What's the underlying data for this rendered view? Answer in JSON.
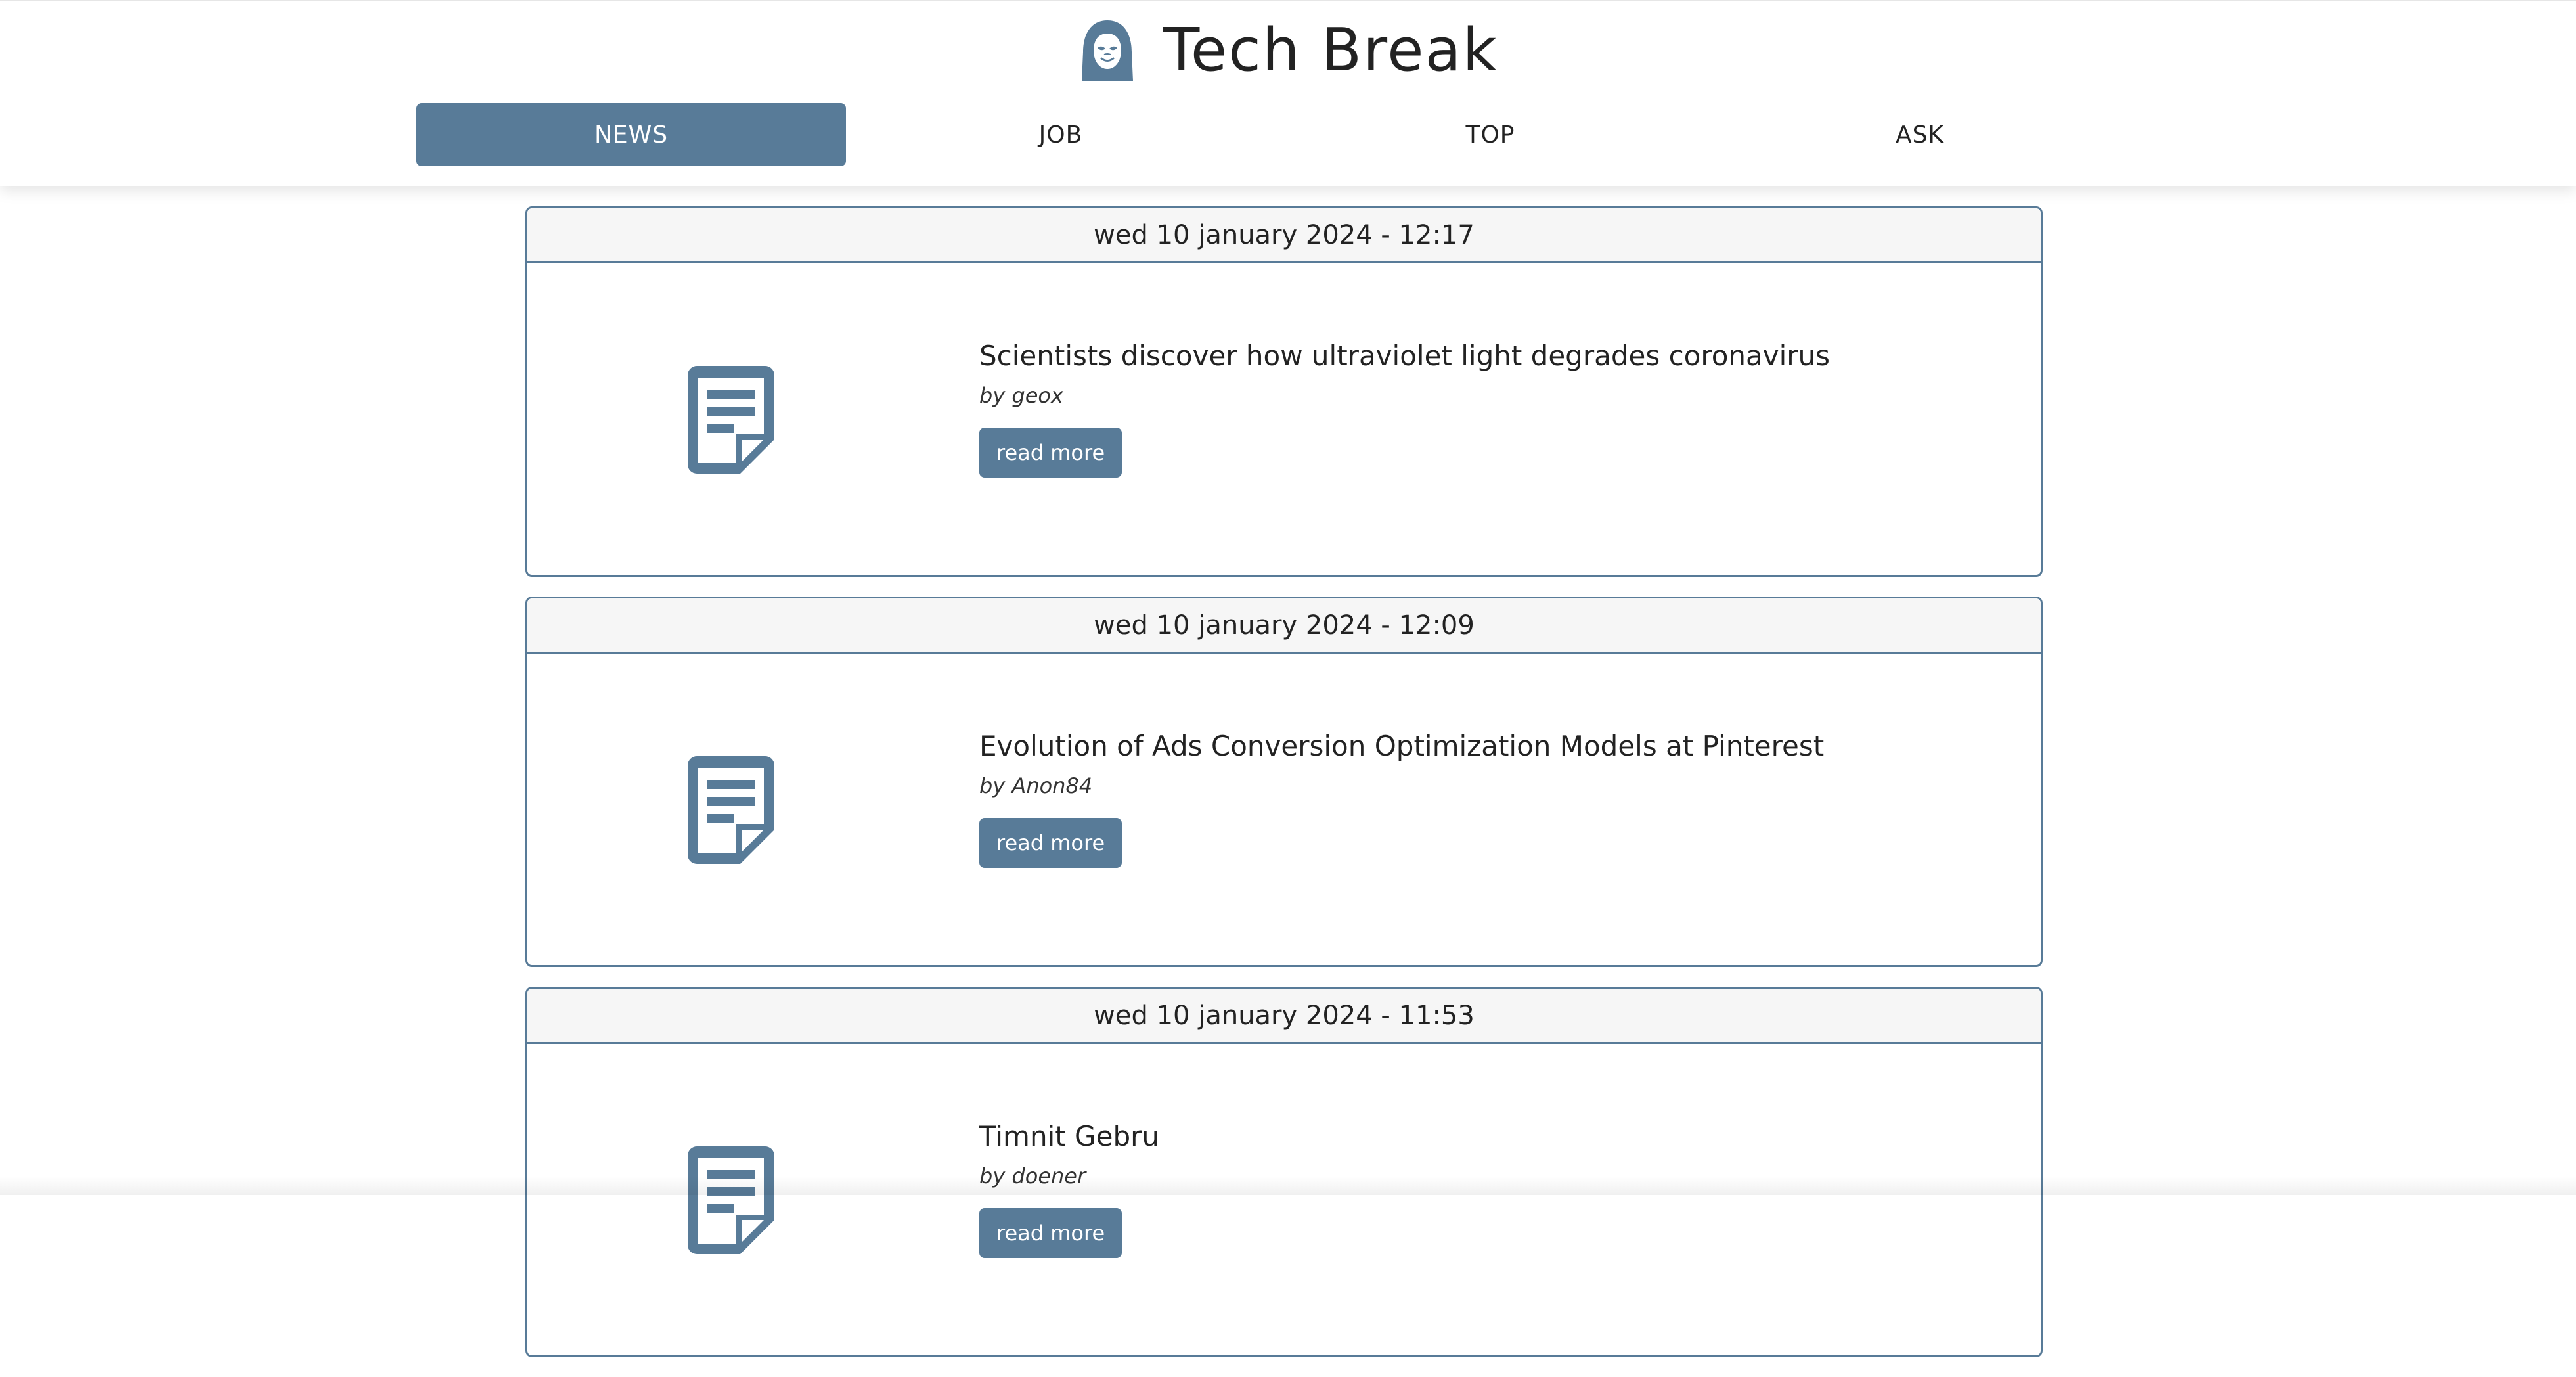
{
  "app": {
    "title": "Tech Break",
    "logo_icon": "hooded-anonymous-mask-icon",
    "accent_color": "#587b98"
  },
  "nav": {
    "tabs": [
      {
        "label": "NEWS",
        "active": true
      },
      {
        "label": "JOB",
        "active": false
      },
      {
        "label": "TOP",
        "active": false
      },
      {
        "label": "ASK",
        "active": false
      }
    ]
  },
  "feed": {
    "items": [
      {
        "date": "wed 10 january 2024 - 12:17",
        "title": "Scientists discover how ultraviolet light degrades coronavirus",
        "author": "by geox",
        "button": "read more",
        "icon": "document-icon"
      },
      {
        "date": "wed 10 january 2024 - 12:09",
        "title": "Evolution of Ads Conversion Optimization Models at Pinterest",
        "author": "by Anon84",
        "button": "read more",
        "icon": "document-icon"
      },
      {
        "date": "wed 10 january 2024 - 11:53",
        "title": "Timnit Gebru",
        "author": "by doener",
        "button": "read more",
        "icon": "document-icon"
      }
    ]
  }
}
